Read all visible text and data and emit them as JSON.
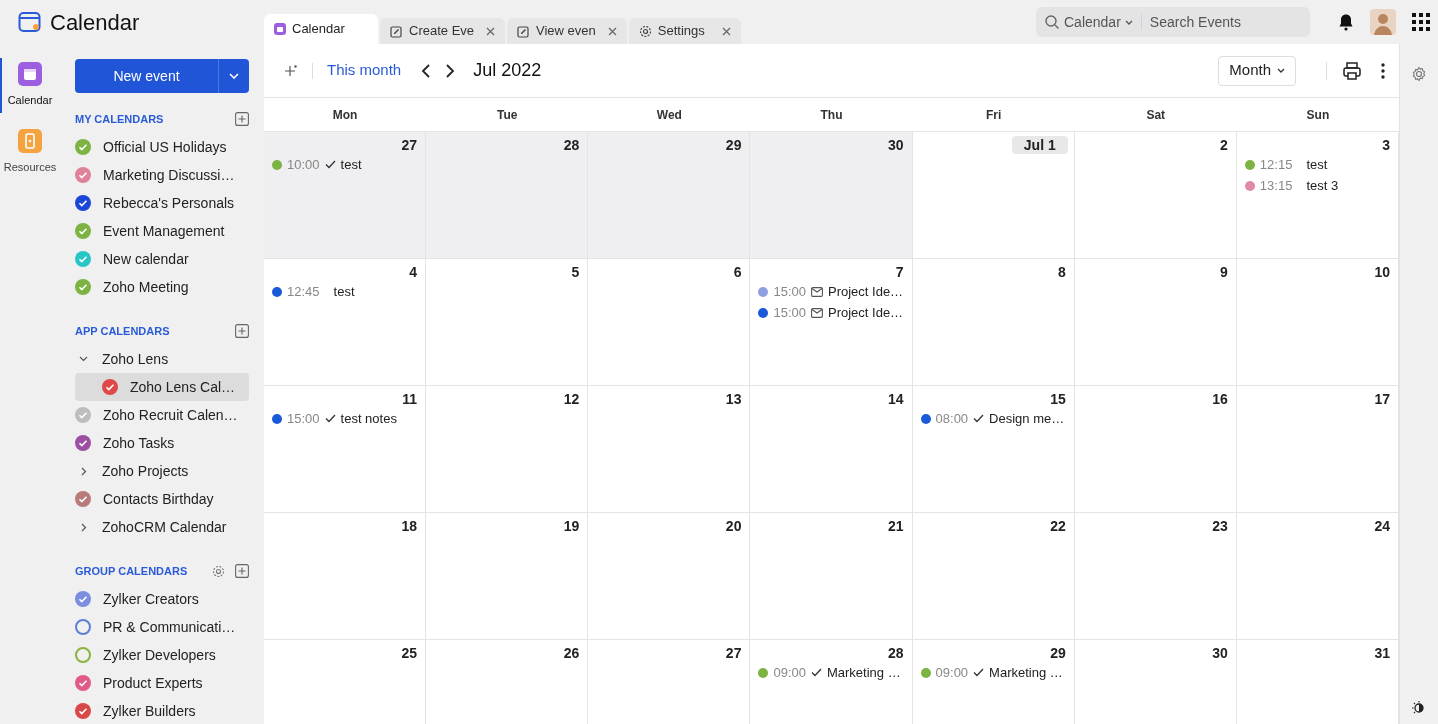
{
  "app": {
    "title": "Calendar"
  },
  "tabs": [
    {
      "label": "Calendar",
      "selected": true,
      "closable": false
    },
    {
      "label": "Create Eve",
      "selected": false,
      "closable": true
    },
    {
      "label": "View even",
      "selected": false,
      "closable": true
    },
    {
      "label": "Settings",
      "selected": false,
      "closable": true
    }
  ],
  "search": {
    "scope": "Calendar",
    "placeholder": "Search Events"
  },
  "rail": [
    {
      "label": "Calendar",
      "selected": true
    },
    {
      "label": "Resources",
      "selected": false
    }
  ],
  "new_event_button": "New event",
  "sections": [
    {
      "title": "MY CALENDARS",
      "has_settings": false,
      "items": [
        {
          "kind": "calendar",
          "label": "Official US Holidays",
          "color": "#7cb342",
          "checked": true
        },
        {
          "kind": "calendar",
          "label": "Marketing Discussi…",
          "color": "#e0819a",
          "checked": true
        },
        {
          "kind": "calendar",
          "label": "Rebecca's Personals",
          "color": "#1a47d8",
          "checked": true
        },
        {
          "kind": "calendar",
          "label": "Event Management",
          "color": "#7cb342",
          "checked": true
        },
        {
          "kind": "calendar",
          "label": "New calendar",
          "color": "#26c6c6",
          "checked": true
        },
        {
          "kind": "calendar",
          "label": "Zoho Meeting",
          "color": "#7cb342",
          "checked": true
        }
      ]
    },
    {
      "title": "APP CALENDARS",
      "has_settings": false,
      "items": [
        {
          "kind": "group",
          "label": "Zoho Lens",
          "expanded": true,
          "children": [
            {
              "kind": "calendar",
              "label": "Zoho Lens Cal…",
              "color": "#e04848",
              "checked": true,
              "selected": true
            }
          ]
        },
        {
          "kind": "calendar",
          "label": "Zoho Recruit Calen…",
          "color": "#bdbdbd",
          "checked": true
        },
        {
          "kind": "calendar",
          "label": "Zoho Tasks",
          "color": "#9c4fa3",
          "checked": true
        },
        {
          "kind": "group",
          "label": "Zoho Projects",
          "expanded": false
        },
        {
          "kind": "calendar",
          "label": "Contacts Birthday",
          "color": "#b97a7a",
          "checked": true
        },
        {
          "kind": "group",
          "label": "ZohoCRM Calendar",
          "expanded": false
        }
      ]
    },
    {
      "title": "GROUP CALENDARS",
      "has_settings": true,
      "items": [
        {
          "kind": "calendar",
          "label": "Zylker Creators",
          "color": "#7b8ee0",
          "checked": true
        },
        {
          "kind": "calendar",
          "label": "PR & Communicati…",
          "color": "#5b7fd6",
          "checked": false
        },
        {
          "kind": "calendar",
          "label": "Zylker Developers",
          "color": "#8ab33f",
          "checked": false
        },
        {
          "kind": "calendar",
          "label": "Product Experts",
          "color": "#e05a8a",
          "checked": true
        },
        {
          "kind": "calendar",
          "label": "Zylker Builders",
          "color": "#d94848",
          "checked": true
        }
      ]
    }
  ],
  "toolbar": {
    "today_button": "This month",
    "period": "Jul 2022",
    "view": "Month"
  },
  "weekdays": [
    "Mon",
    "Tue",
    "Wed",
    "Thu",
    "Fri",
    "Sat",
    "Sun"
  ],
  "weeks": [
    [
      {
        "day": "27",
        "other_month": true,
        "events": [
          {
            "time": "10:00",
            "kind": "task",
            "title": "test",
            "color": "#7cb342"
          }
        ]
      },
      {
        "day": "28",
        "other_month": true
      },
      {
        "day": "29",
        "other_month": true
      },
      {
        "day": "30",
        "other_month": true
      },
      {
        "day": "Jul 1",
        "other_month": false,
        "today": true
      },
      {
        "day": "2",
        "other_month": false
      },
      {
        "day": "3",
        "other_month": false,
        "events": [
          {
            "time": "12:15",
            "kind": "event",
            "title": "test",
            "color": "#7cb342"
          },
          {
            "time": "13:15",
            "kind": "event",
            "title": "test 3",
            "color": "#e08aa8"
          }
        ]
      }
    ],
    [
      {
        "day": "4",
        "other_month": false,
        "events": [
          {
            "time": "12:45",
            "kind": "event",
            "title": "test",
            "color": "#1a5ad8"
          }
        ]
      },
      {
        "day": "5",
        "other_month": false
      },
      {
        "day": "6",
        "other_month": false
      },
      {
        "day": "7",
        "other_month": false,
        "events": [
          {
            "time": "15:00",
            "kind": "invite",
            "title": "Project Ide…",
            "color": "#8f9fe0"
          },
          {
            "time": "15:00",
            "kind": "invite",
            "title": "Project Ide…",
            "color": "#1a5ad8"
          }
        ]
      },
      {
        "day": "8",
        "other_month": false
      },
      {
        "day": "9",
        "other_month": false
      },
      {
        "day": "10",
        "other_month": false
      }
    ],
    [
      {
        "day": "11",
        "other_month": false,
        "events": [
          {
            "time": "15:00",
            "kind": "task",
            "title": "test notes",
            "color": "#1a5ad8"
          }
        ]
      },
      {
        "day": "12",
        "other_month": false
      },
      {
        "day": "13",
        "other_month": false
      },
      {
        "day": "14",
        "other_month": false
      },
      {
        "day": "15",
        "other_month": false,
        "events": [
          {
            "time": "08:00",
            "kind": "task",
            "title": "Design me…",
            "color": "#1a5ad8"
          }
        ]
      },
      {
        "day": "16",
        "other_month": false
      },
      {
        "day": "17",
        "other_month": false
      }
    ],
    [
      {
        "day": "18",
        "other_month": false
      },
      {
        "day": "19",
        "other_month": false
      },
      {
        "day": "20",
        "other_month": false
      },
      {
        "day": "21",
        "other_month": false
      },
      {
        "day": "22",
        "other_month": false
      },
      {
        "day": "23",
        "other_month": false
      },
      {
        "day": "24",
        "other_month": false
      }
    ],
    [
      {
        "day": "25",
        "other_month": false
      },
      {
        "day": "26",
        "other_month": false
      },
      {
        "day": "27",
        "other_month": false
      },
      {
        "day": "28",
        "other_month": false,
        "events": [
          {
            "time": "09:00",
            "kind": "task",
            "title": "Marketing …",
            "color": "#7cb342"
          }
        ]
      },
      {
        "day": "29",
        "other_month": false,
        "events": [
          {
            "time": "09:00",
            "kind": "task",
            "title": "Marketing …",
            "color": "#7cb342"
          }
        ]
      },
      {
        "day": "30",
        "other_month": false
      },
      {
        "day": "31",
        "other_month": false
      }
    ]
  ]
}
